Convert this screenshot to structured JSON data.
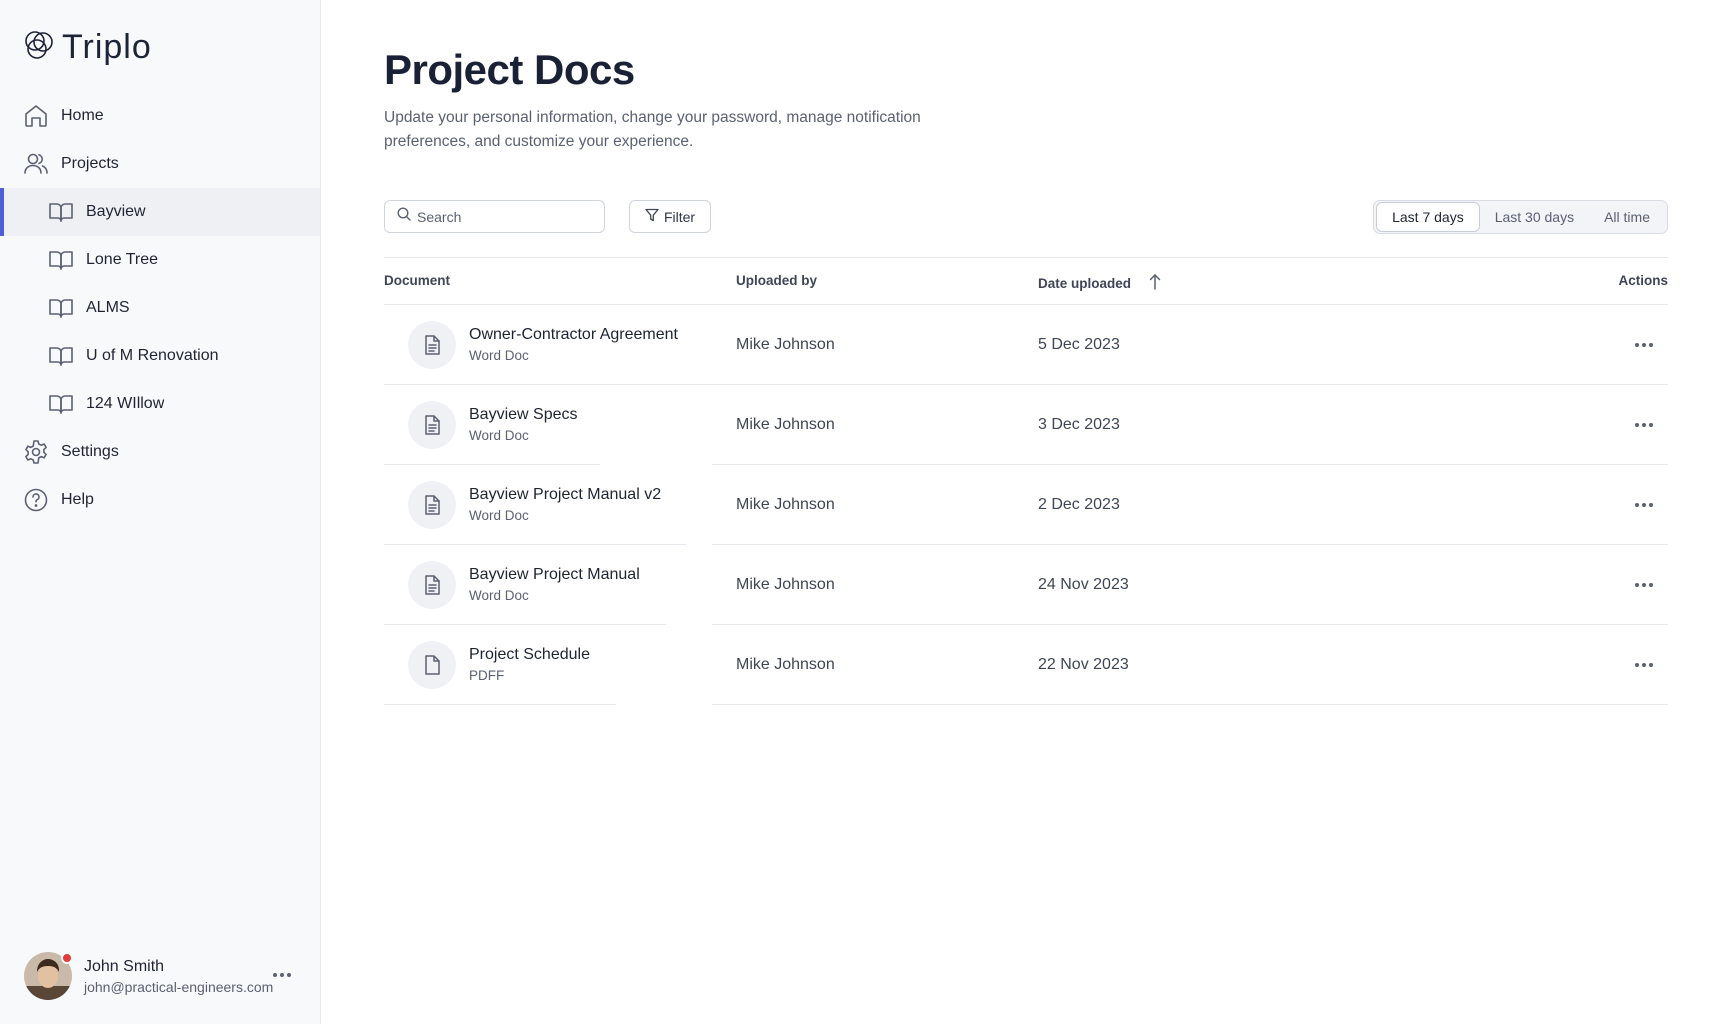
{
  "app": {
    "name": "Triplo"
  },
  "sidebar": {
    "items": [
      {
        "label": "Home",
        "icon": "home-icon"
      },
      {
        "label": "Projects",
        "icon": "users-icon"
      },
      {
        "label": "Bayview",
        "icon": "book-icon",
        "active": true
      },
      {
        "label": "Lone Tree",
        "icon": "book-icon"
      },
      {
        "label": "ALMS",
        "icon": "book-icon"
      },
      {
        "label": "U of M Renovation",
        "icon": "book-icon"
      },
      {
        "label": "124 WIllow",
        "icon": "book-icon"
      },
      {
        "label": "Settings",
        "icon": "gear-icon"
      },
      {
        "label": "Help",
        "icon": "help-circle-icon"
      }
    ],
    "user": {
      "name": "John Smith",
      "email": "john@practical-engineers.com",
      "status_color": "#e23b3b"
    }
  },
  "page": {
    "title": "Project Docs",
    "subtitle": "Update your personal information, change your password, manage notification preferences, and customize your experience."
  },
  "toolbar": {
    "search_placeholder": "Search",
    "filter_label": "Filter",
    "ranges": [
      "Last 7 days",
      "Last 30 days",
      "All time"
    ],
    "selected_range": "Last 7 days"
  },
  "table": {
    "columns": {
      "document": "Document",
      "uploaded_by": "Uploaded by",
      "date_uploaded": "Date uploaded",
      "actions": "Actions"
    },
    "rows": [
      {
        "name": "Owner-Contractor Agreement",
        "type": "Word Doc",
        "uploaded_by": "Mike Johnson",
        "date": "5 Dec 2023",
        "icon": "document-text-icon"
      },
      {
        "name": "Bayview Specs",
        "type": "Word Doc",
        "uploaded_by": "Mike Johnson",
        "date": "3 Dec 2023",
        "icon": "document-text-icon"
      },
      {
        "name": "Bayview Project Manual v2",
        "type": "Word Doc",
        "uploaded_by": "Mike Johnson",
        "date": "2 Dec 2023",
        "icon": "document-text-icon"
      },
      {
        "name": "Bayview Project Manual",
        "type": "Word Doc",
        "uploaded_by": "Mike Johnson",
        "date": "24 Nov 2023",
        "icon": "document-text-icon"
      },
      {
        "name": "Project Schedule",
        "type": "PDFF",
        "uploaded_by": "Mike Johnson",
        "date": "22 Nov 2023",
        "icon": "document-blank-icon"
      }
    ]
  },
  "colors": {
    "accent": "#4f5fd6",
    "text": "#1f2433",
    "muted": "#5b6173"
  }
}
